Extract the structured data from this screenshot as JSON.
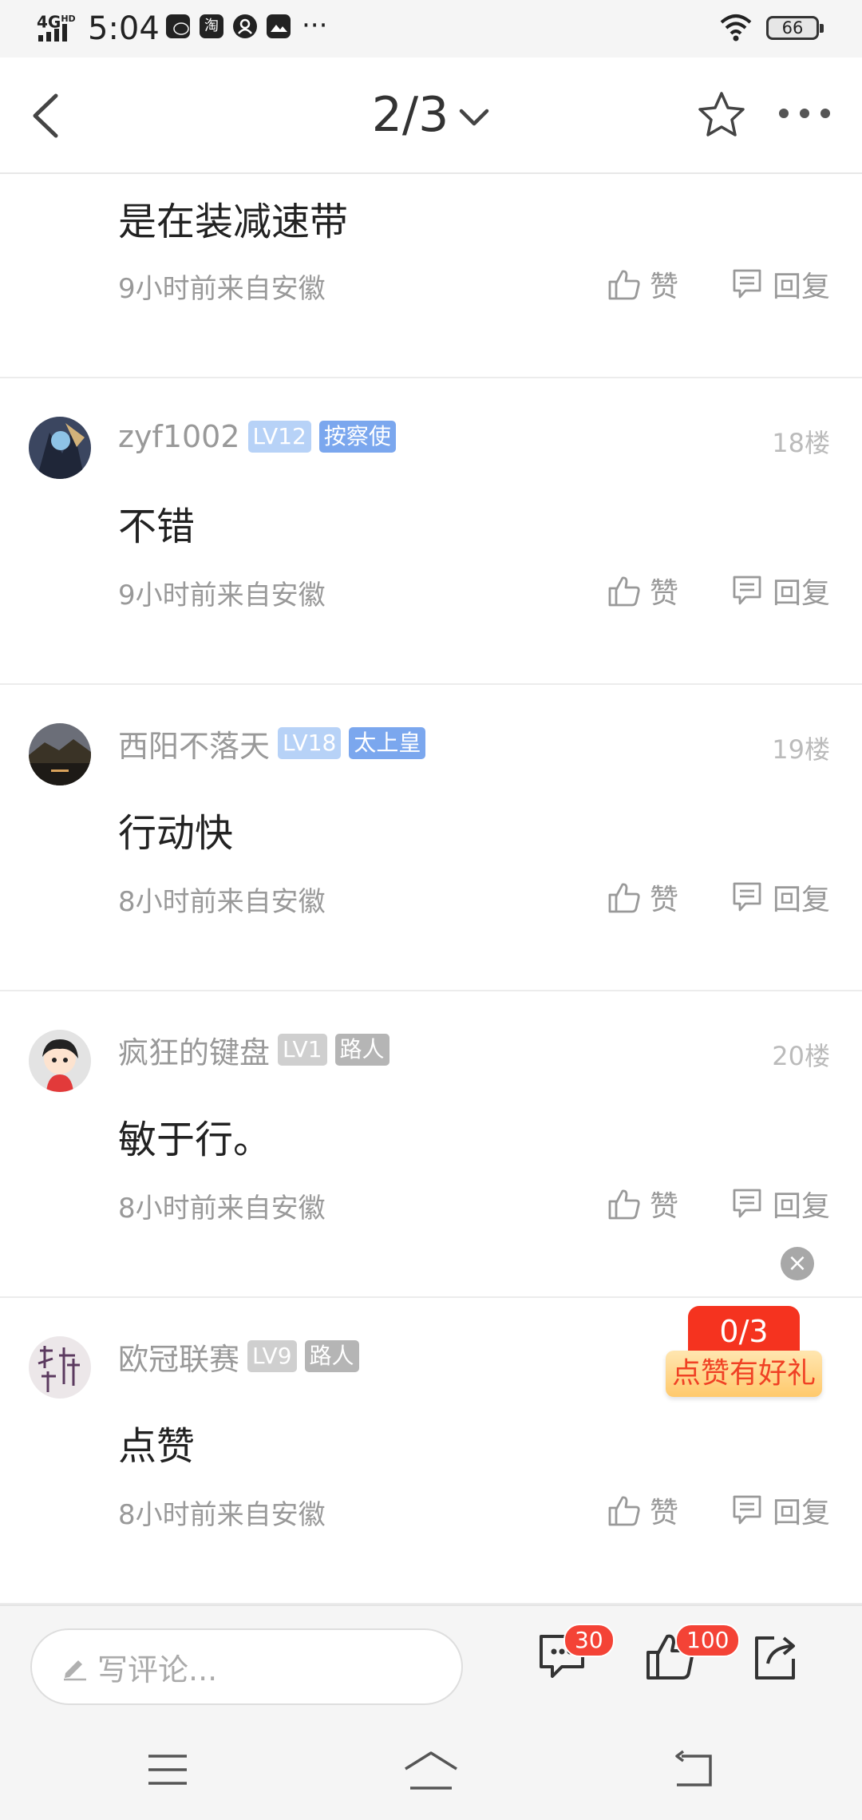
{
  "status_bar": {
    "network": "4G",
    "network_sup": "HD",
    "time": "5:04",
    "more": "···",
    "battery": "66",
    "app_icons": [
      "wechat-icon",
      "taobao-icon",
      "notification-icon",
      "gallery-icon"
    ],
    "taobao_glyph": "淘"
  },
  "nav": {
    "page_indicator": "2/3"
  },
  "comments": [
    {
      "content": "是在装减速带",
      "meta": "9小时前来自安徽",
      "like_label": "赞",
      "reply_label": "回复"
    },
    {
      "username": "zyf1002",
      "level": "LV12",
      "title": "按察使",
      "floor": "18楼",
      "content": "不错",
      "meta": "9小时前来自安徽",
      "like_label": "赞",
      "reply_label": "回复"
    },
    {
      "username": "西阳不落天",
      "level": "LV18",
      "title": "太上皇",
      "floor": "19楼",
      "content": "行动快",
      "meta": "8小时前来自安徽",
      "like_label": "赞",
      "reply_label": "回复"
    },
    {
      "username": "疯狂的键盘",
      "level": "LV1",
      "title": "路人",
      "floor": "20楼",
      "content": "敏于行。",
      "meta": "8小时前来自安徽",
      "like_label": "赞",
      "reply_label": "回复"
    },
    {
      "username": "欧冠联赛",
      "level": "LV9",
      "title": "路人",
      "floor": "",
      "content": "点赞",
      "meta": "8小时前来自安徽",
      "like_label": "赞",
      "reply_label": "回复"
    }
  ],
  "promo": {
    "count": "0/3",
    "label": "点赞有好礼",
    "close": "×"
  },
  "bottom_bar": {
    "comment_placeholder": "写评论...",
    "comment_count": "30",
    "like_count": "100"
  }
}
